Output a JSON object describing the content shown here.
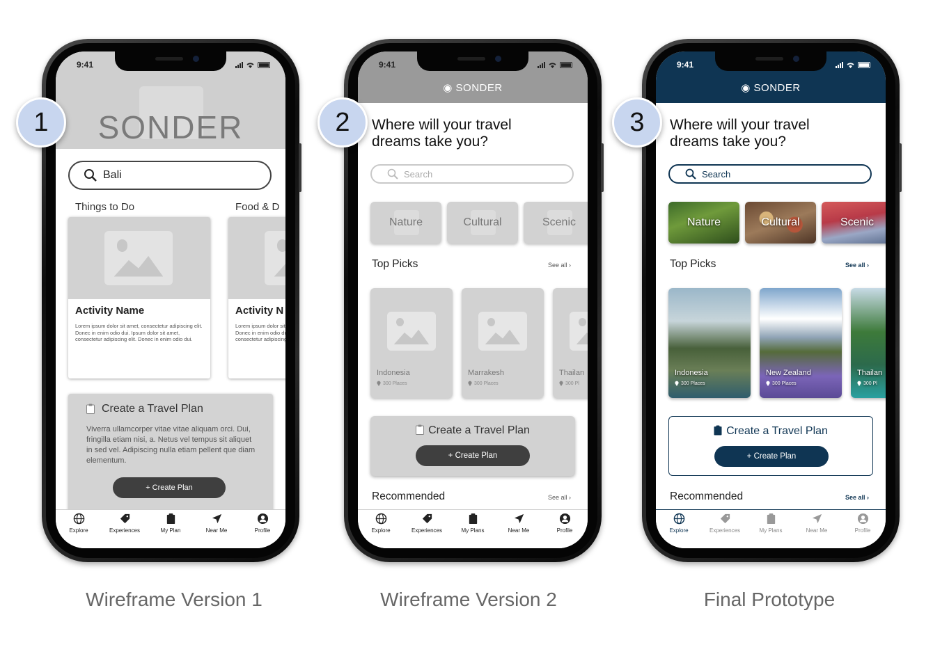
{
  "status_time": "9:41",
  "tabs_v1": [
    "Explore",
    "Experiences",
    "My Plan",
    "Near Me",
    "Profile"
  ],
  "tabs_v2": [
    "Explore",
    "Experiences",
    "My Plans",
    "Near Me",
    "Profile"
  ],
  "phone1": {
    "badge": "1",
    "hero_title": "SONDER",
    "search_value": "Bali",
    "sections": [
      "Things to Do",
      "Food & D"
    ],
    "cards": [
      {
        "name": "Activity Name",
        "desc": "Lorem ipsum dolor sit amet, consectetur adipiscing elit. Donec in enim odio dui. Ipsum dolor sit amet, consectetur adipiscing elit. Donec in enim odio dui."
      },
      {
        "name": "Activity N",
        "desc": "Lorem ipsum dolor sit amet, consectetur adipiscing elit. Donec in enim odio dui. Ipsum dolor sit amet, consectetur adipiscing elit. Donec in enim odio dui."
      }
    ],
    "plan_title": "Create a Travel Plan",
    "plan_desc": "Viverra ullamcorper vitae vitae aliquam orci. Dui, fringilla etiam nisi, a. Netus vel tempus sit aliquet in sed vel. Adipiscing nulla etiam pellent que diam elementum.",
    "plan_button": "+ Create Plan",
    "caption": "Wireframe Version 1"
  },
  "phone2": {
    "badge": "2",
    "brand": "SONDER",
    "question_line1": "Where will your travel",
    "question_line2": "dreams take you?",
    "search_placeholder": "Search",
    "categories": [
      "Nature",
      "Cultural",
      "Scenic"
    ],
    "top_picks": "Top Picks",
    "see_all": "See all",
    "destinations": [
      {
        "name": "Indonesia",
        "places": "300 Places"
      },
      {
        "name": "Marrakesh",
        "places": "300 Places"
      },
      {
        "name": "Thailan",
        "places": "300 Pl"
      }
    ],
    "plan_title": "Create a Travel Plan",
    "plan_button": "+ Create Plan",
    "recommended": "Recommended",
    "caption": "Wireframe Version 2"
  },
  "phone3": {
    "badge": "3",
    "brand": "SONDER",
    "question_line1": "Where will your travel",
    "question_line2": "dreams take you?",
    "search_placeholder": "Search",
    "categories": [
      "Nature",
      "Cultural",
      "Scenic"
    ],
    "top_picks": "Top Picks",
    "see_all": "See all",
    "destinations": [
      {
        "name": "Indonesia",
        "places": "300 Places"
      },
      {
        "name": "New Zealand",
        "places": "300 Places"
      },
      {
        "name": "Thailan",
        "places": "300 Pl"
      }
    ],
    "plan_title": "Create a Travel Plan",
    "plan_button": "+ Create Plan",
    "recommended": "Recommended",
    "caption": "Final Prototype"
  },
  "colors": {
    "final_navy": "#0f3553",
    "wire_gray": "#d2d2d2",
    "badge_blue": "#c8d6ef"
  }
}
